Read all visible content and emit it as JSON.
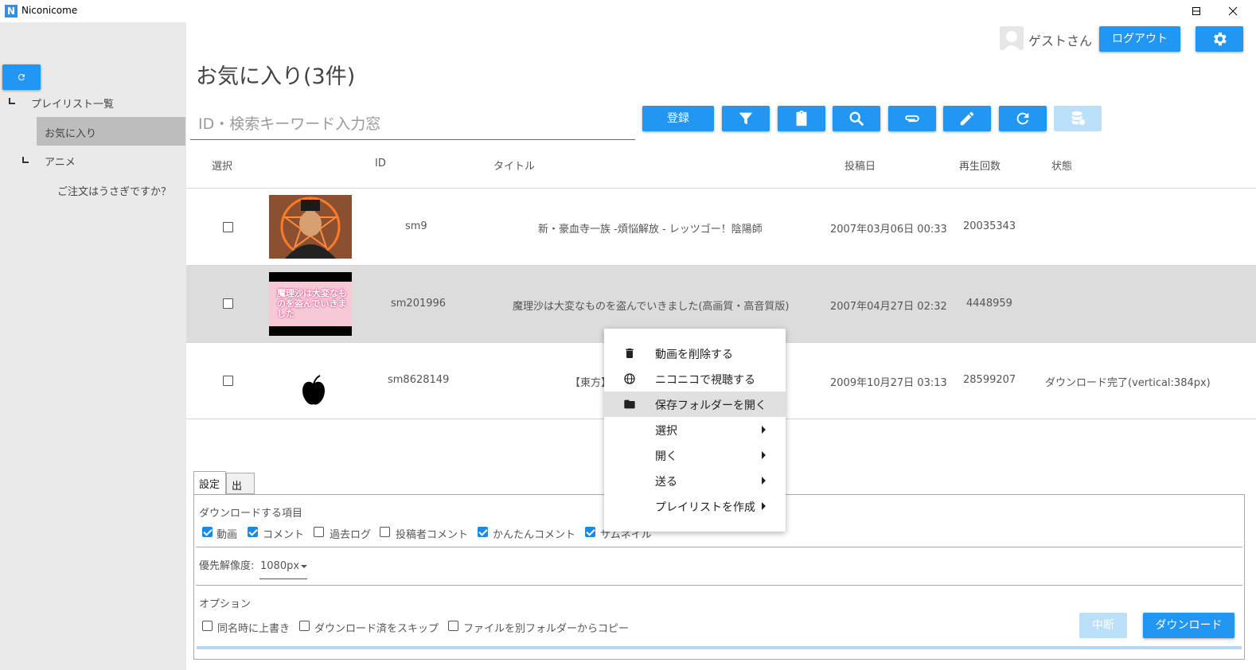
{
  "window": {
    "title": "Niconicome",
    "logo": "N"
  },
  "sidebar": {
    "tree": [
      {
        "label": "プレイリスト一覧"
      },
      {
        "label": "お気に入り"
      },
      {
        "label": "アニメ"
      },
      {
        "label": "ご注文はうさぎですか？"
      }
    ]
  },
  "header": {
    "user": "ゲストさん",
    "logout": "ログアウト"
  },
  "page": {
    "title": "お気に入り(3件)"
  },
  "search": {
    "placeholder": "ID・検索キーワード入力窓",
    "value": ""
  },
  "toolbar": {
    "register": "登録"
  },
  "table": {
    "columns": [
      "選択",
      "ID",
      "タイトル",
      "投稿日",
      "再生回数",
      "状態"
    ],
    "rows": [
      {
        "id": "sm9",
        "title": "新・豪血寺一族 -煩悩解放 - レッツゴー！陰陽師",
        "date": "2007年03月06日 00:33",
        "views": "20035343",
        "status": ""
      },
      {
        "id": "sm201996",
        "title": "魔理沙は大変なものを盗んでいきました(高画質・高音質版)",
        "date": "2007年04月27日 02:32",
        "views": "4448959",
        "status": "",
        "thumb_text": "魔理沙は大変なものを盗んでいきました"
      },
      {
        "id": "sm8628149",
        "title": "【東方】",
        "date": "2009年10月27日 03:13",
        "views": "28599207",
        "status": "ダウンロード完了(vertical:384px)"
      }
    ]
  },
  "context_menu": {
    "items": [
      {
        "label": "動画を削除する",
        "icon": "trash-icon"
      },
      {
        "label": "ニコニコで視聴する",
        "icon": "globe-icon"
      },
      {
        "label": "保存フォルダーを開く",
        "icon": "folder-icon"
      },
      {
        "label": "選択"
      },
      {
        "label": "開く"
      },
      {
        "label": "送る"
      },
      {
        "label": "プレイリストを作成"
      }
    ]
  },
  "panel": {
    "tabs": [
      "設定",
      "出力"
    ],
    "download_items_label": "ダウンロードする項目",
    "items": [
      {
        "label": "動画",
        "checked": true
      },
      {
        "label": "コメント",
        "checked": true
      },
      {
        "label": "過去ログ",
        "checked": false
      },
      {
        "label": "投稿者コメント",
        "checked": false
      },
      {
        "label": "かんたんコメント",
        "checked": true
      },
      {
        "label": "サムネイル",
        "checked": true
      }
    ],
    "resolution_label": "優先解像度:",
    "resolution_value": "1080px",
    "options_label": "オプション",
    "options": [
      {
        "label": "同名時に上書き",
        "checked": false
      },
      {
        "label": "ダウンロード済をスキップ",
        "checked": false
      },
      {
        "label": "ファイルを別フォルダーからコピー",
        "checked": false
      }
    ],
    "abort": "中断",
    "download": "ダウンロード"
  },
  "colors": {
    "accent": "#2196f3",
    "disabled": "#bcdff9",
    "sidebar": "#eaeaea",
    "selected_row": "#dcdcdc"
  }
}
